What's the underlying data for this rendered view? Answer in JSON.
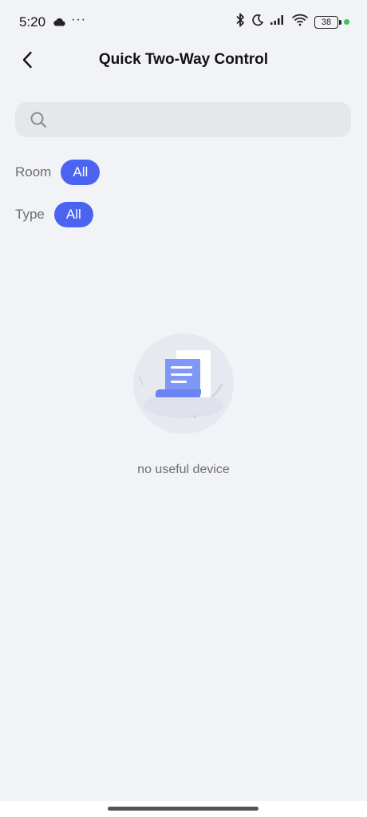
{
  "status_bar": {
    "time": "5:20",
    "dots": "···",
    "battery": "38",
    "icons": [
      "cloud-icon",
      "bluetooth-icon",
      "moon-icon",
      "signal-icon",
      "wifi-icon",
      "battery-icon"
    ]
  },
  "header": {
    "title": "Quick Two-Way Control",
    "back_icon": "chevron-left-icon"
  },
  "search": {
    "placeholder": "",
    "value": ""
  },
  "filters": [
    {
      "label": "Room",
      "selected": "All"
    },
    {
      "label": "Type",
      "selected": "All"
    }
  ],
  "empty_state": {
    "message": "no useful device",
    "illustration": "document-empty-icon"
  },
  "colors": {
    "background": "#f2f3f7",
    "accent": "#4b63f0",
    "search_bg": "#e6e7eb",
    "muted_text": "#6d6e73"
  }
}
